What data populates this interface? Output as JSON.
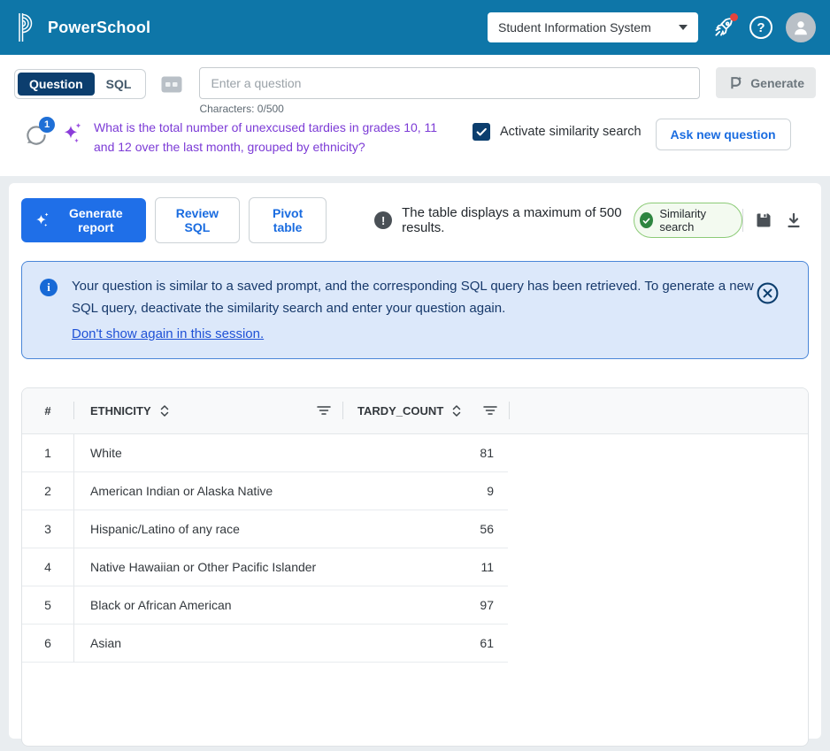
{
  "header": {
    "brand": "PowerSchool",
    "product_selector": "Student Information System"
  },
  "query_bar": {
    "tabs": [
      {
        "label": "Question",
        "active": true
      },
      {
        "label": "SQL",
        "active": false
      }
    ],
    "input_placeholder": "Enter a question",
    "char_counter": "Characters: 0/500",
    "generate_label": "Generate"
  },
  "history": {
    "badge_count": "1",
    "question": "What is the total number of unexcused tardies in grades 10, 11 and 12 over the last month, grouped by ethnicity?",
    "similarity_checkbox_label": "Activate similarity search",
    "similarity_checked": true,
    "ask_new_label": "Ask new question"
  },
  "toolbar": {
    "generate_report_label": "Generate report",
    "review_sql_label": "Review SQL",
    "pivot_table_label": "Pivot table",
    "max_results_notice": "The table displays a maximum of 500 results.",
    "similarity_badge_label": "Similarity search"
  },
  "banner": {
    "message": "Your question is similar to a saved prompt, and the corresponding SQL query has been retrieved. To generate a new SQL query, deactivate the similarity search and enter your question again.",
    "dismiss_link": "Don't show again in this session."
  },
  "table": {
    "columns": [
      {
        "label": "#"
      },
      {
        "label": "ETHNICITY",
        "sortable": true,
        "filterable": true
      },
      {
        "label": "TARDY_COUNT",
        "sortable": true,
        "filterable": true
      }
    ],
    "rows": [
      {
        "num": "1",
        "ethnicity": "White",
        "tardy_count": "81"
      },
      {
        "num": "2",
        "ethnicity": "American Indian or Alaska Native",
        "tardy_count": "9"
      },
      {
        "num": "3",
        "ethnicity": "Hispanic/Latino of any race",
        "tardy_count": "56"
      },
      {
        "num": "4",
        "ethnicity": "Native Hawaiian or Other Pacific Islander",
        "tardy_count": "11"
      },
      {
        "num": "5",
        "ethnicity": "Black or African American",
        "tardy_count": "97"
      },
      {
        "num": "6",
        "ethnicity": "Asian",
        "tardy_count": "61"
      }
    ]
  },
  "colors": {
    "header_bg": "#0e76a8",
    "accent_navy": "#0c3e6e",
    "primary_blue": "#1f6fe8",
    "link_blue": "#1a6ce0",
    "question_purple": "#7c3bd6",
    "banner_bg": "#dce8fa",
    "banner_border": "#4a86d8",
    "success_green": "#2e8540",
    "notification_red": "#e5433b"
  }
}
